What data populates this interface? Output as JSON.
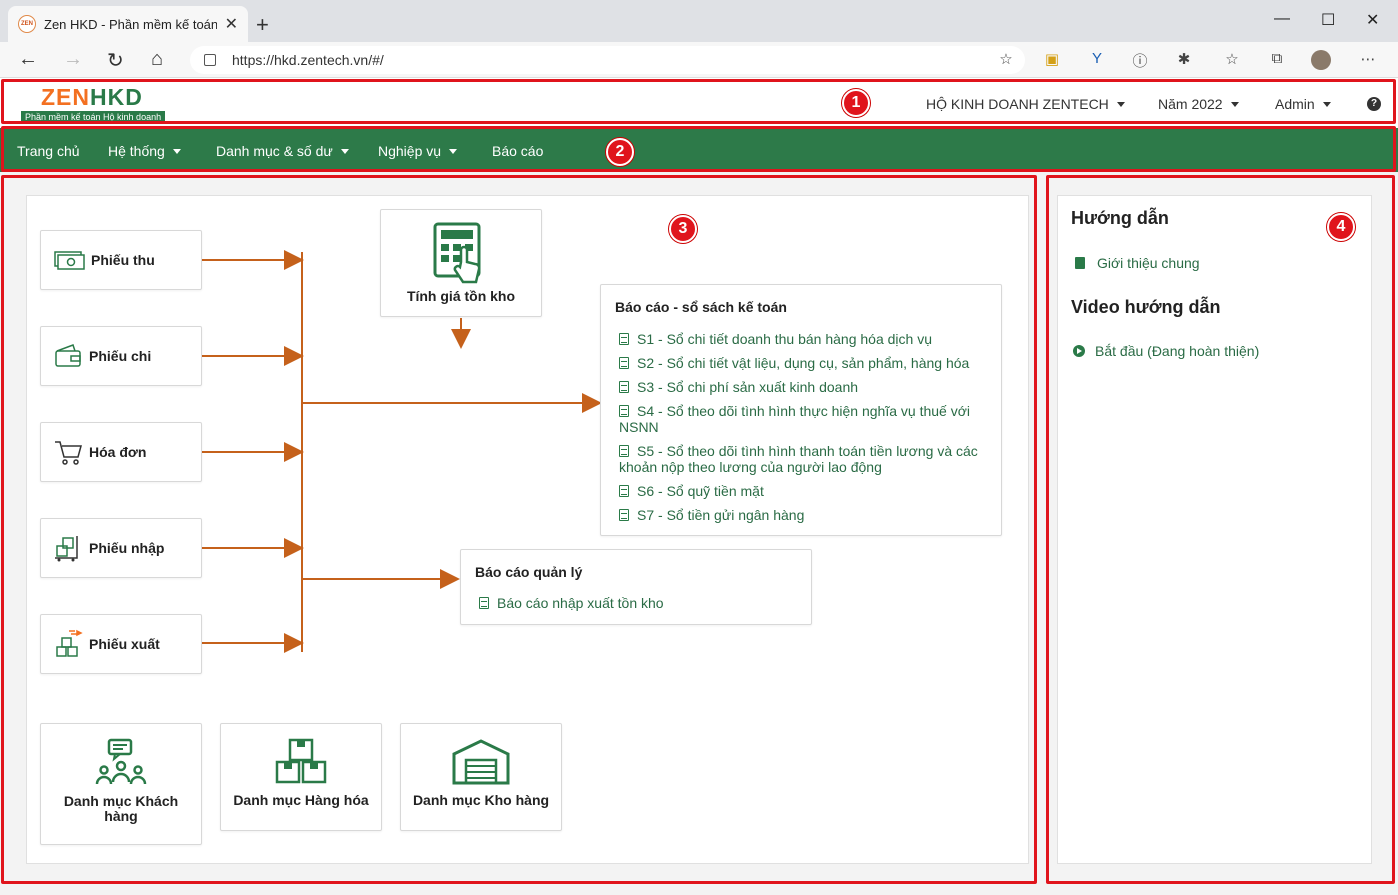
{
  "browser": {
    "tab_title": "Zen HKD - Phần mềm kế toán Hộ",
    "favicon_text": "ZEN",
    "url": "https://hkd.zentech.vn/#/"
  },
  "header": {
    "logo_zen": "ZEN",
    "logo_hkd": "HKD",
    "logo_sub": "Phần mềm kế toán Hộ kinh doanh",
    "company": "HỘ KINH DOANH ZENTECH",
    "year": "Năm 2022",
    "user": "Admin"
  },
  "nav": {
    "items": [
      "Trang chủ",
      "Hệ thống",
      "Danh mục & số dư",
      "Nghiệp vụ",
      "Báo cáo"
    ]
  },
  "badges": [
    "1",
    "2",
    "3",
    "4"
  ],
  "documents": [
    "Phiếu thu",
    "Phiếu chi",
    "Hóa đơn",
    "Phiếu nhập",
    "Phiếu xuất"
  ],
  "inventory": {
    "label": "Tính giá tồn kho"
  },
  "accounting_reports": {
    "title": "Báo cáo - sổ sách kế toán",
    "links": [
      "S1 - Sổ chi tiết doanh thu bán hàng hóa dịch vụ",
      "S2 - Sổ chi tiết vật liệu, dụng cụ, sản phẩm, hàng hóa",
      "S3 - Sổ chi phí sản xuất kinh doanh",
      "S4 - Sổ theo dõi tình hình thực hiện nghĩa vụ thuế với NSNN",
      "S5 - Sổ theo dõi tình hình thanh toán tiền lương và các khoản nộp theo lương của người lao động",
      "S6 - Sổ quỹ tiền mặt",
      "S7 - Sổ tiền gửi ngân hàng"
    ]
  },
  "management_reports": {
    "title": "Báo cáo quản lý",
    "links": [
      "Báo cáo nhập xuất tồn kho"
    ]
  },
  "catalogs": [
    "Danh mục Khách hàng",
    "Danh mục Hàng hóa",
    "Danh mục Kho hàng"
  ],
  "sidebar": {
    "guide_title": "Hướng dẫn",
    "guide_link": "Giới thiệu chung",
    "video_title": "Video hướng dẫn",
    "video_link": "Bắt đầu (Đang hoàn thiện)"
  },
  "colors": {
    "brand_green": "#2d7a49",
    "brand_orange": "#f37021",
    "arrow": "#c5611b",
    "highlight_red": "#e0141c"
  }
}
